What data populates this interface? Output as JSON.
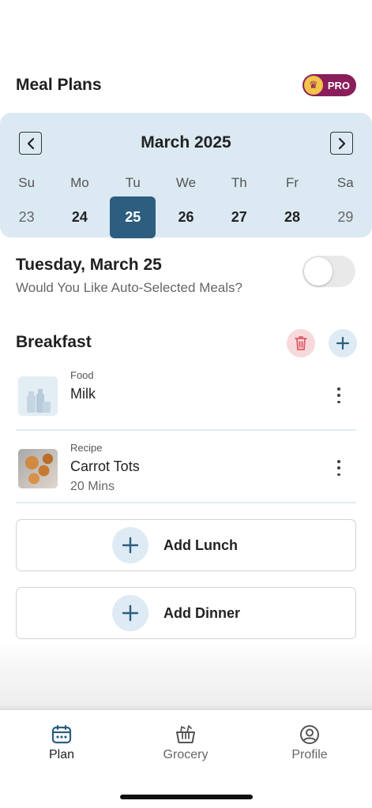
{
  "header": {
    "title": "Meal Plans",
    "pro_label": "PRO"
  },
  "calendar": {
    "month": "March 2025",
    "days": [
      {
        "name": "Su",
        "num": "23"
      },
      {
        "name": "Mo",
        "num": "24"
      },
      {
        "name": "Tu",
        "num": "25"
      },
      {
        "name": "We",
        "num": "26"
      },
      {
        "name": "Th",
        "num": "27"
      },
      {
        "name": "Fr",
        "num": "28"
      },
      {
        "name": "Sa",
        "num": "29"
      }
    ],
    "selected": "25"
  },
  "day_detail": {
    "heading": "Tuesday, March 25",
    "auto_question": "Would You Like Auto-Selected Meals?",
    "auto_enabled": false
  },
  "breakfast": {
    "title": "Breakfast",
    "items": [
      {
        "type": "Food",
        "name": "Milk",
        "sub": ""
      },
      {
        "type": "Recipe",
        "name": "Carrot Tots",
        "sub": "20 Mins"
      }
    ]
  },
  "add_lunch": "Add Lunch",
  "add_dinner": "Add Dinner",
  "tabs": [
    {
      "label": "Plan",
      "icon": "calendar-icon"
    },
    {
      "label": "Grocery",
      "icon": "grocery-basket-icon"
    },
    {
      "label": "Profile",
      "icon": "profile-icon"
    }
  ],
  "colors": {
    "accent": "#2d5e7f",
    "calendar_bg": "#dbe9f3",
    "pro_badge": "#8a1e5a",
    "delete_bg": "#f7d9dc"
  }
}
